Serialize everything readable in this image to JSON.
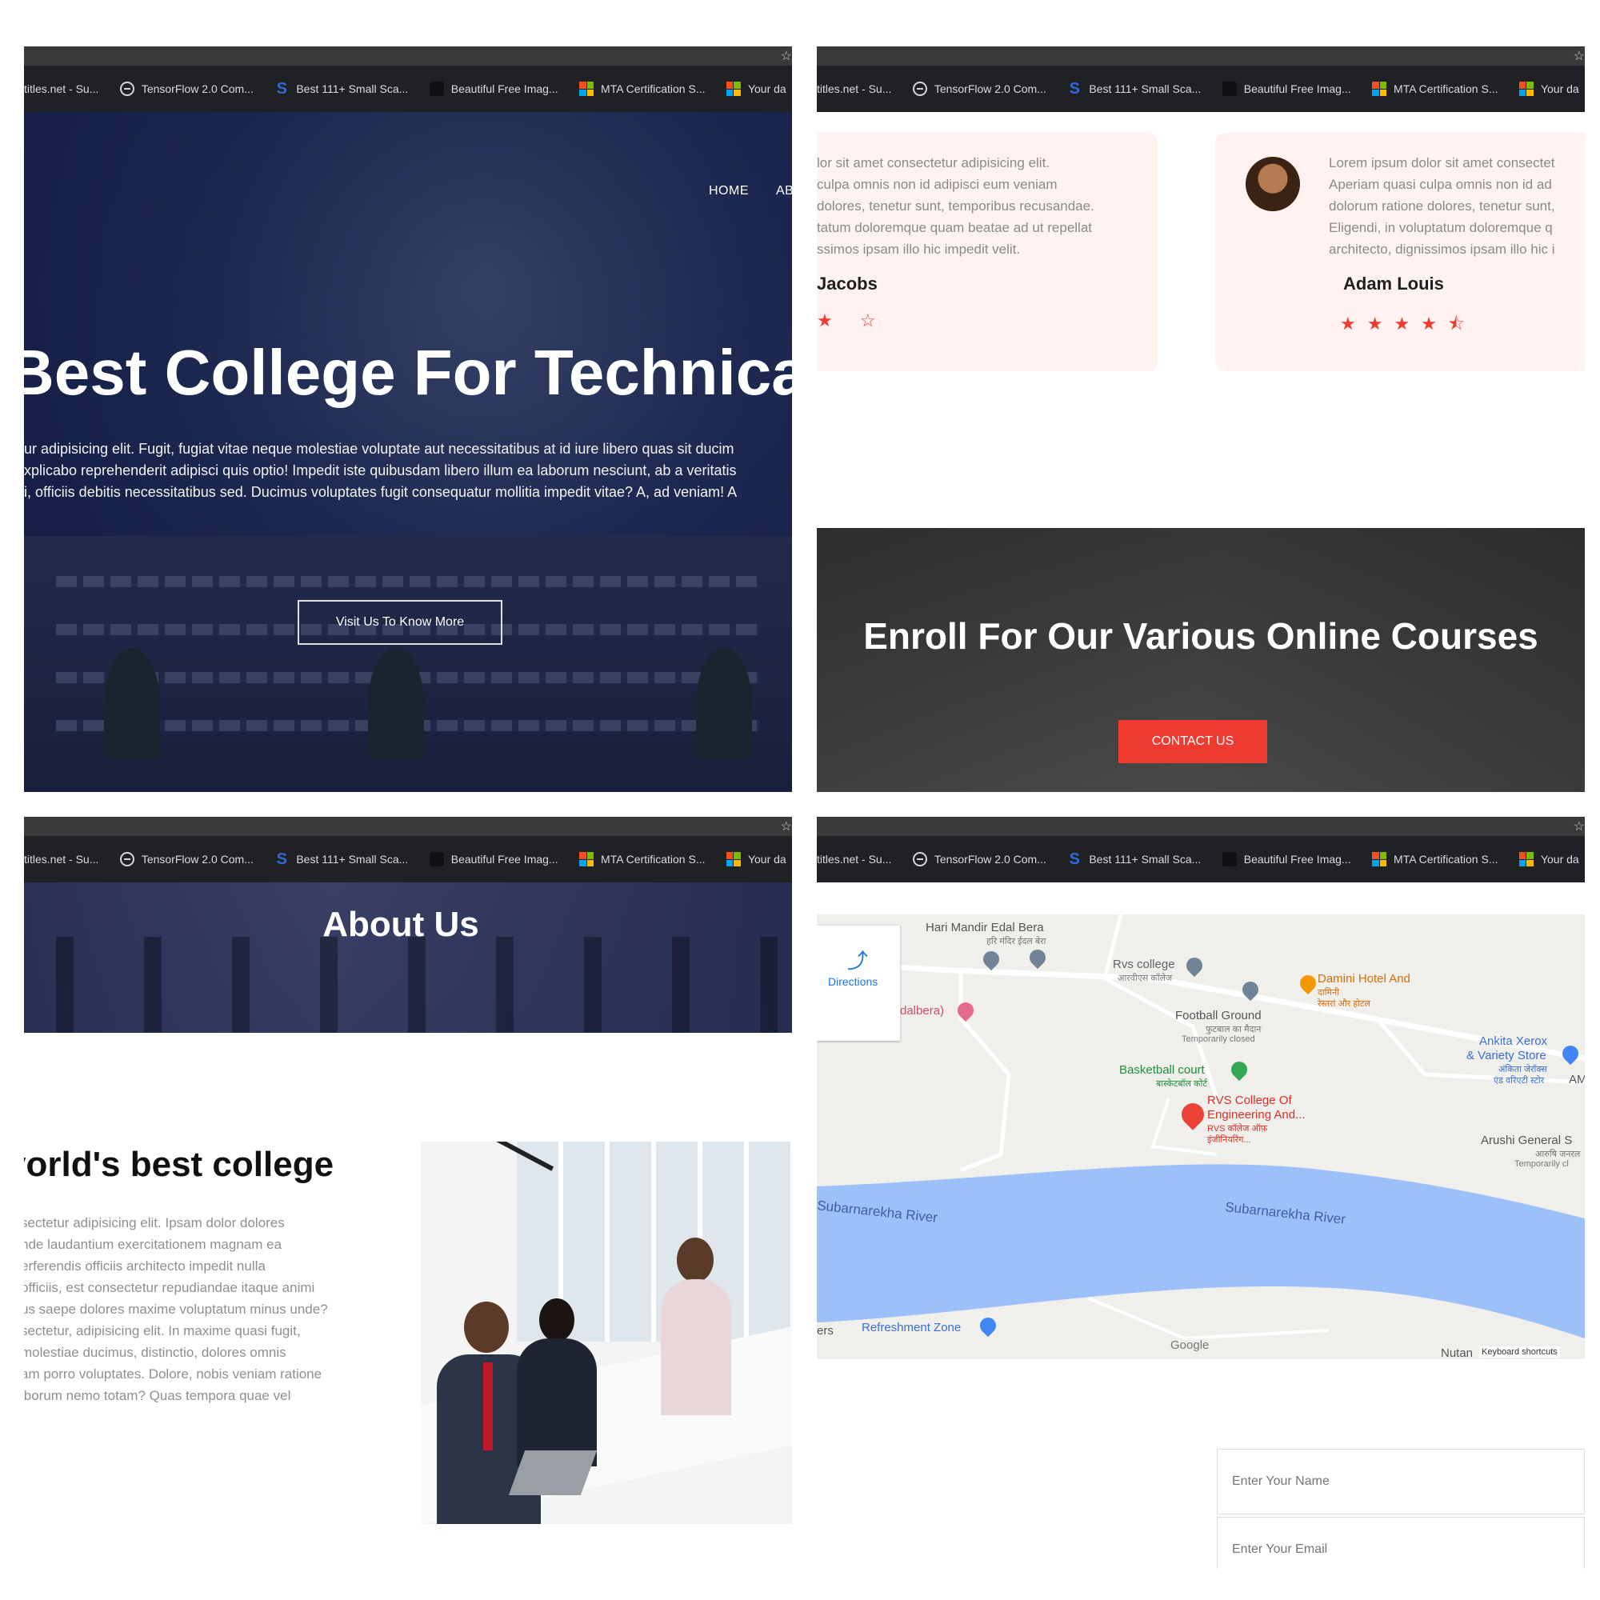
{
  "bookmarks": [
    "titles.net - Su...",
    "TensorFlow 2.0 Com...",
    "Best 111+ Small Sca...",
    "Beautiful Free Imag...",
    "MTA Certification S...",
    "Your da"
  ],
  "hero": {
    "nav_home": "HOME",
    "nav_about": "AB",
    "title": "Best College For Technica",
    "text_lines": [
      "ur adipisicing elit. Fugit, fugiat vitae neque molestiae voluptate aut necessitatibus at id iure libero quas sit ducim",
      "xplicabo reprehenderit adipisci quis optio! Impedit iste quibusdam libero illum ea laborum nesciunt, ab a veritatis",
      "i, officiis debitis necessitatibus sed. Ducimus voluptates fugit consequatur mollitia impedit vitae? A, ad veniam! A"
    ],
    "button": "Visit Us To Know More"
  },
  "testimonials": [
    {
      "lines": [
        "lor sit amet consectetur adipisicing elit.",
        "culpa omnis non id adipisci eum veniam",
        "dolores, tenetur sunt, temporibus recusandae.",
        "tatum doloremque quam beatae ad ut repellat",
        "ssimos ipsam illo hic impedit velit."
      ],
      "name": "Jacobs",
      "stars": "★ ☆"
    },
    {
      "lines": [
        "Lorem ipsum dolor sit amet consectet",
        "Aperiam quasi culpa omnis non id ad",
        "dolorum ratione dolores, tenetur sunt,",
        "Eligendi, in voluptatum doloremque q",
        "architecto, dignissimos ipsam illo hic i"
      ],
      "name": "Adam Louis",
      "stars": "★★★★⯪"
    }
  ],
  "enroll": {
    "title": "Enroll For Our Various Online Courses",
    "button": "CONTACT US"
  },
  "about": {
    "banner_title": "About Us",
    "heading": "vorld's best college",
    "lines": [
      "sectetur adipisicing elit. Ipsam dolor dolores",
      "nde laudantium exercitationem magnam ea",
      "erferendis officiis architecto impedit nulla",
      "officiis, est consectetur repudiandae itaque animi",
      "us saepe dolores maxime voluptatum minus unde?",
      "sectetur, adipisicing elit. In maxime quasi fugit,",
      "molestiae ducimus, distinctio, dolores omnis",
      "am porro voluptates. Dolore, nobis veniam ratione",
      "iborum nemo totam? Quas tempora quae vel"
    ]
  },
  "map": {
    "directions": "Directions",
    "places": {
      "hari_mandir": "Hari Mandir Edal Bera",
      "hari_mandir_hi": "हरि मंदिर ईदल बेरा",
      "rvs_college": "Rvs college",
      "rvs_college_hi": "आरवीएस कॉलेज",
      "damini": "Damini Hotel And",
      "damini_hi": "दामिनी",
      "damini_hi2": "रेस्तरां और होटल",
      "football": "Football Ground",
      "football_hi": "फुटबाल का मैदान",
      "football_status": "Temporarily closed",
      "dalbera": "dalbera)",
      "ankita": "Ankita Xerox",
      "ankita2": "& Variety Store",
      "ankita_hi": "अंकिता जेरॉक्स",
      "ankita_hi2": "एंड वरिएटी स्टोर",
      "am": "AM",
      "basketball": "Basketball court",
      "basketball_hi": "बास्केटबॉल कोर्ट",
      "rvs_eng": "RVS College Of",
      "rvs_eng2": "Engineering And...",
      "rvs_eng_hi": "RVS कॉलेज ऑफ़",
      "rvs_eng_hi2": "इंजीनियरिंग...",
      "arushi": "Arushi General S",
      "arushi_hi": "आरुषि जनरल",
      "arushi_status": "Temporarily cl",
      "river1": "Subarnarekha River",
      "river2": "Subarnarekha River",
      "refreshment": "Refreshment Zone",
      "ers": "ers",
      "google": "Google",
      "nutan": "Nutan",
      "keyboard": "Keyboard shortcuts"
    }
  },
  "form": {
    "name_placeholder": "Enter Your Name",
    "email_placeholder": "Enter Your Email"
  },
  "colors": {
    "accent": "#ef3b2f",
    "hero_overlay": "#1c2a5a",
    "card_bg": "#fff2f1",
    "river": "#9cc0f9"
  }
}
